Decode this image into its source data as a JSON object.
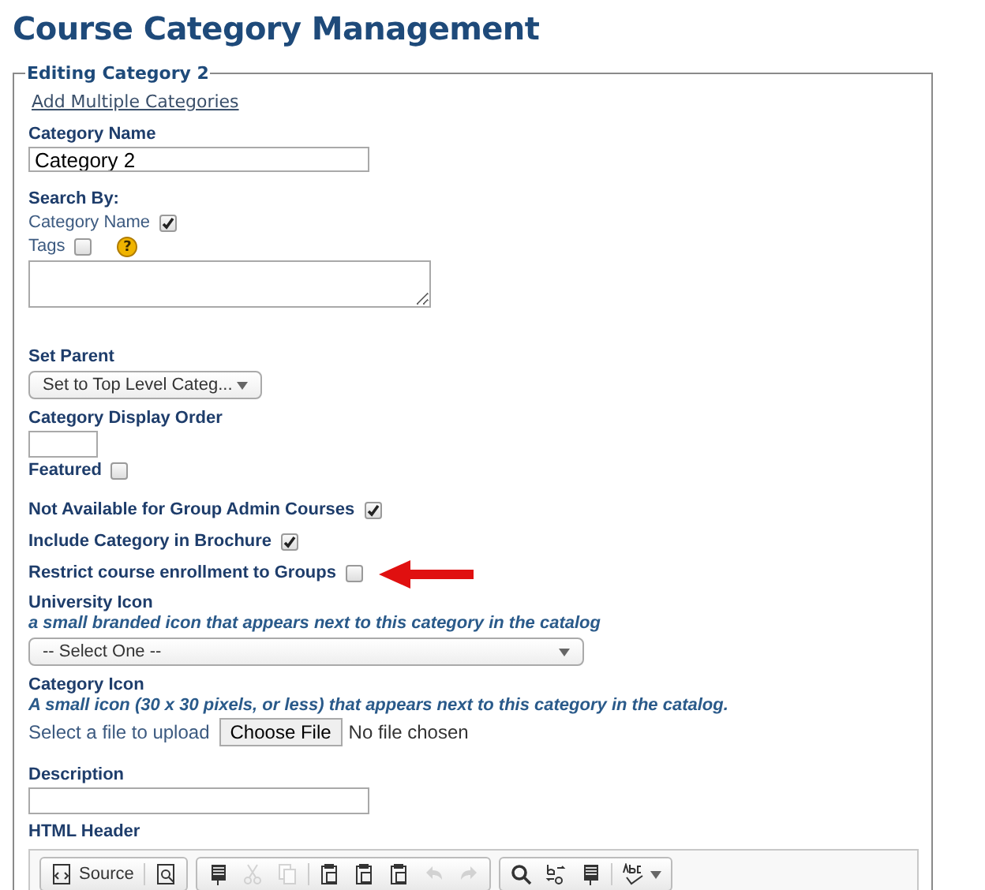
{
  "page_title": "Course Category Management",
  "fieldset": {
    "legend": "Editing Category 2",
    "link": "Add Multiple Categories"
  },
  "category_name": {
    "label": "Category Name",
    "value": "Category 2"
  },
  "search_by": {
    "label": "Search By:",
    "options": [
      {
        "label": "Category Name",
        "checked": true
      },
      {
        "label": "Tags",
        "checked": false,
        "help": "?"
      }
    ]
  },
  "set_parent": {
    "label": "Set Parent",
    "value": "Set to Top Level Categ..."
  },
  "display_order": {
    "label": "Category Display Order"
  },
  "featured": {
    "label": "Featured",
    "checked": false
  },
  "flags": [
    {
      "label": "Not Available for Group Admin Courses",
      "checked": true,
      "highlighted": false
    },
    {
      "label": "Include Category in Brochure",
      "checked": true,
      "highlighted": false
    },
    {
      "label": "Restrict course enrollment to Groups",
      "checked": false,
      "highlighted": true
    }
  ],
  "university_icon": {
    "label": "University Icon",
    "hint": "a small branded icon that appears next to this category in the catalog",
    "value": "-- Select One --"
  },
  "category_icon": {
    "label": "Category Icon",
    "hint": "A small icon (30 x 30 pixels, or less) that appears next to this category in the catalog.",
    "prompt": "Select a file to upload",
    "button": "Choose File",
    "status": "No file chosen"
  },
  "description": {
    "label": "Description"
  },
  "html_header": {
    "label": "HTML Header",
    "toolbar": [
      [
        {
          "kind": "source",
          "text": "Source",
          "disabled": false
        },
        {
          "kind": "preview",
          "disabled": false
        }
      ],
      [
        {
          "kind": "template",
          "disabled": false
        },
        {
          "kind": "cut",
          "disabled": true
        },
        {
          "kind": "copy",
          "disabled": true
        },
        {
          "kind": "paste",
          "disabled": false
        },
        {
          "kind": "paste",
          "disabled": false
        },
        {
          "kind": "paste",
          "disabled": false
        },
        {
          "kind": "undo",
          "disabled": true
        },
        {
          "kind": "redo",
          "disabled": true
        }
      ],
      [
        {
          "kind": "find",
          "disabled": false
        },
        {
          "kind": "replace",
          "disabled": false
        },
        {
          "kind": "template",
          "disabled": false
        },
        {
          "kind": "spell",
          "disabled": false
        }
      ]
    ]
  }
}
